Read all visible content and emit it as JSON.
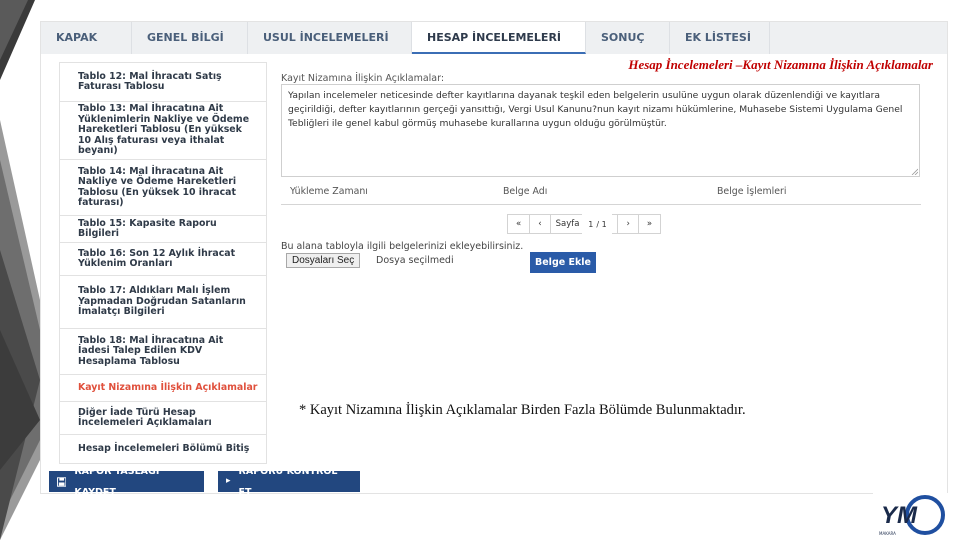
{
  "tabs": [
    "KAPAK",
    "GENEL BİLGİ",
    "USUL İNCELEMELERİ",
    "HESAP İNCELEMELERİ",
    "SONUÇ",
    "EK LİSTESİ"
  ],
  "active_tab_index": 3,
  "sidebar": {
    "items": [
      "Tablo 12: Mal İhracatı Satış Faturası Tablosu",
      "Tablo 13: Mal İhracatına Ait Yüklenimlerin Nakliye ve Ödeme Hareketleri Tablosu (En yüksek 10 Alış faturası veya ithalat beyanı)",
      "Tablo 14: Mal İhracatına Ait Nakliye ve Ödeme Hareketleri Tablosu (En yüksek 10 ihracat faturası)",
      "Tablo 15: Kapasite Raporu Bilgileri",
      "Tablo 16: Son 12 Aylık İhracat Yüklenim Oranları",
      "Tablo 17: Aldıkları Malı İşlem Yapmadan Doğrudan Satanların İmalatçı Bilgileri",
      "Tablo 18: Mal İhracatına Ait İadesi Talep Edilen KDV Hesaplama Tablosu",
      "Kayıt Nizamına İlişkin Açıklamalar",
      "Diğer İade Türü Hesap İncelemeleri Açıklamaları",
      "Hesap İncelemeleri Bölümü Bitiş"
    ],
    "active_index": 7
  },
  "heading": "Hesap İncelemeleri –Kayıt Nizamına İlişkin Açıklamalar",
  "form": {
    "label": "Kayıt Nizamına İlişkin Açıklamalar:",
    "text": "Yapılan incelemeler neticesinde defter kayıtlarına dayanak teşkil eden belgelerin usulüne uygun olarak düzenlendiği ve kayıtlara geçirildiği, defter kayıtlarının gerçeği yansıttığı, Vergi Usul Kanunu?nun kayıt nizamı hükümlerine, Muhasebe Sistemi Uygulama Genel Tebliğleri ile genel kabul görmüş muhasebe kurallarına uygun olduğu görülmüştür."
  },
  "table": {
    "columns": [
      "Yükleme Zamanı",
      "Belge Adı",
      "Belge İşlemleri"
    ]
  },
  "pager": {
    "first": "«",
    "prev": "‹",
    "page_label": "Sayfa",
    "page_value": "1",
    "page_total": "/ 1",
    "next": "›",
    "last": "»"
  },
  "upload": {
    "hint": "Bu alana tabloyla ilgili belgelerinizi ekleyebilirsiniz.",
    "file_button": "Dosyaları Seç",
    "file_status": "Dosya seçilmedi",
    "add_button": "Belge Ekle"
  },
  "note": "* Kayıt Nizamına İlişkin Açıklamalar Birden Fazla Bölümde Bulunmaktadır.",
  "actions": {
    "save": "RAPOR TASLAĞI KAYDET",
    "check": "RAPORU KONTROL ET"
  },
  "logo": {
    "letters": "YM",
    "subtext": "MAKARA"
  },
  "colors": {
    "accent_blue": "#2a5ba8",
    "dark_blue": "#22477f",
    "heading_red": "#c00000",
    "active_item": "#e0503c"
  }
}
